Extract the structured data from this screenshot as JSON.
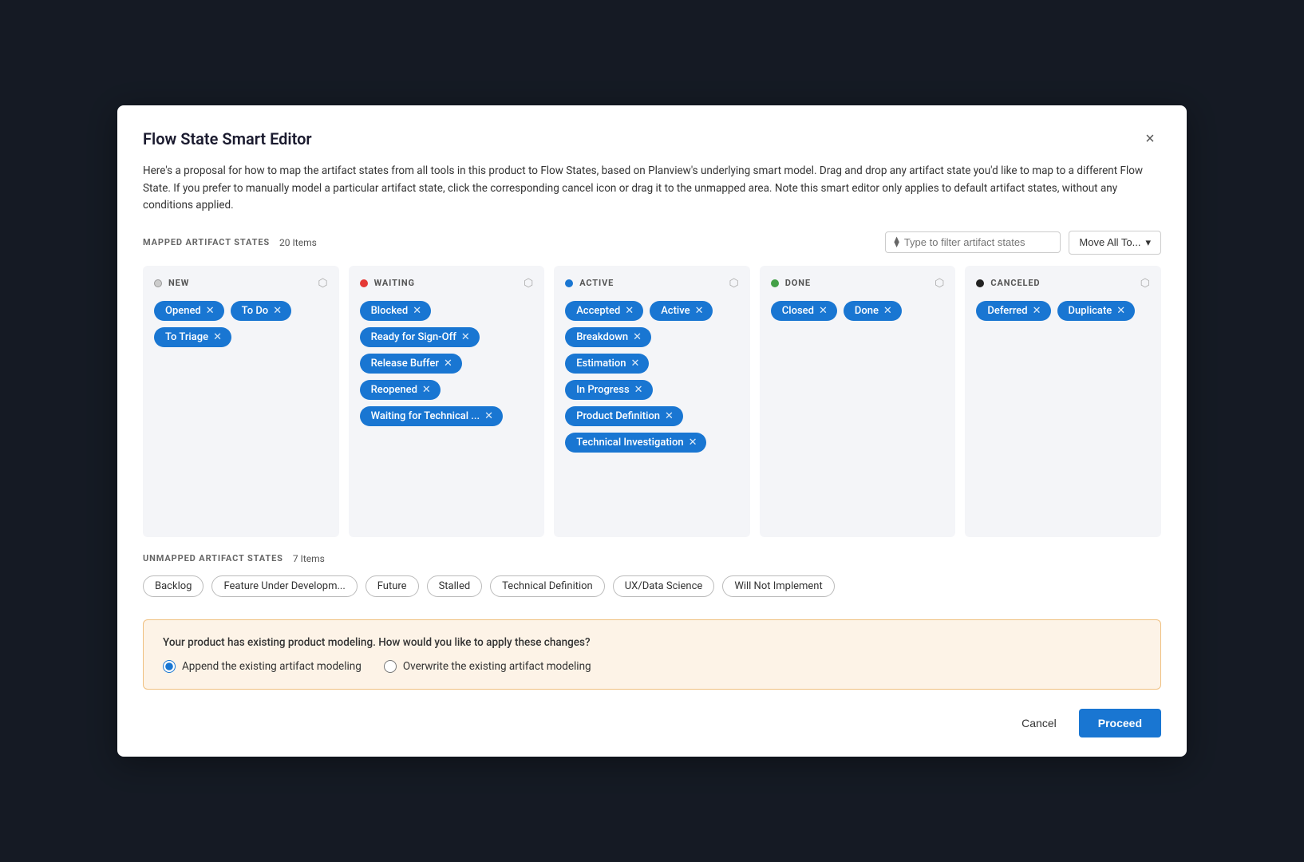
{
  "modal": {
    "title": "Flow State Smart Editor",
    "description": "Here's a proposal for how to map the artifact states from all tools in this product to Flow States, based on Planview's underlying smart model. Drag and drop any artifact state you'd like to map to a different Flow State. If you prefer to manually model a particular artifact state, click the corresponding cancel icon or drag it to the unmapped area. Note this smart editor only applies to default artifact states, without any conditions applied.",
    "close_label": "×"
  },
  "mapped_section": {
    "label": "MAPPED ARTIFACT STATES",
    "count": "20 Items",
    "filter_placeholder": "Type to filter artifact states",
    "move_all_label": "Move All To...",
    "move_all_icon": "▾"
  },
  "columns": [
    {
      "id": "new",
      "dot": "none",
      "title": "NEW",
      "tags": [
        "Opened",
        "To Do",
        "To Triage"
      ]
    },
    {
      "id": "waiting",
      "dot": "red",
      "title": "WAITING",
      "tags": [
        "Blocked",
        "Ready for Sign-Off",
        "Release Buffer",
        "Reopened",
        "Waiting for Technical ..."
      ]
    },
    {
      "id": "active",
      "dot": "blue",
      "title": "ACTIVE",
      "tags": [
        "Accepted",
        "Active",
        "Breakdown",
        "Estimation",
        "In Progress",
        "Product Definition",
        "Technical Investigation"
      ]
    },
    {
      "id": "done",
      "dot": "green",
      "title": "DONE",
      "tags": [
        "Closed",
        "Done"
      ]
    },
    {
      "id": "canceled",
      "dot": "black",
      "title": "CANCELED",
      "tags": [
        "Deferred",
        "Duplicate"
      ]
    }
  ],
  "unmapped_section": {
    "label": "UNMAPPED ARTIFACT STATES",
    "count": "7 Items",
    "tags": [
      "Backlog",
      "Feature Under Developm...",
      "Future",
      "Stalled",
      "Technical Definition",
      "UX/Data Science",
      "Will Not Implement"
    ]
  },
  "notice": {
    "text": "Your product has existing product modeling. How would you like to apply these changes?",
    "option1_label": "Append the existing artifact modeling",
    "option2_label": "Overwrite the existing artifact modeling",
    "option1_checked": true,
    "option2_checked": false
  },
  "footer": {
    "cancel_label": "Cancel",
    "proceed_label": "Proceed"
  }
}
